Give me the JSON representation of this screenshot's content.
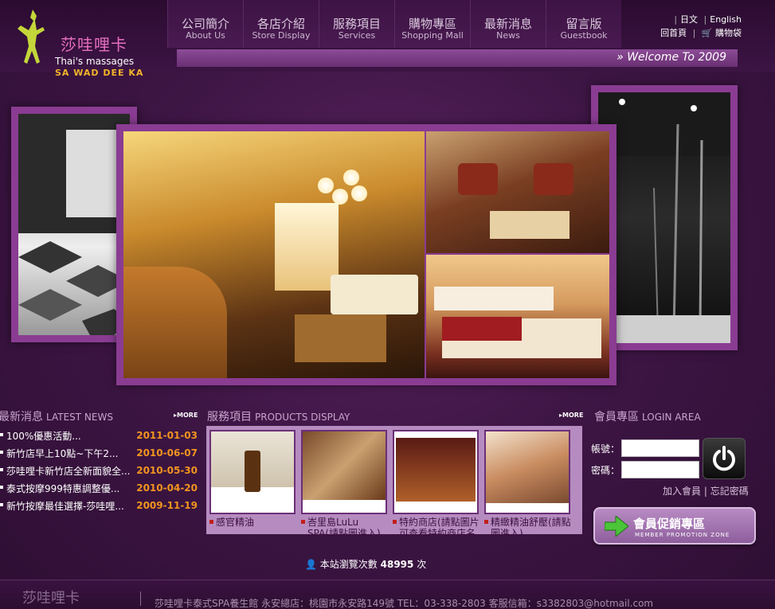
{
  "header": {
    "logo_cn": "莎哇哩卡",
    "logo_en": "Thai's massages",
    "logo_en2": "SA WAD DEE KA",
    "nav": [
      {
        "zh": "公司簡介",
        "en": "About Us"
      },
      {
        "zh": "各店介紹",
        "en": "Store Display"
      },
      {
        "zh": "服務項目",
        "en": "Services"
      },
      {
        "zh": "購物專區",
        "en": "Shopping Mall"
      },
      {
        "zh": "最新消息",
        "en": "News"
      },
      {
        "zh": "留言版",
        "en": "Guestbook"
      }
    ],
    "lang_ja": "日文",
    "lang_en": "English",
    "home": "回首頁",
    "cart": "購物袋",
    "welcome": "Welcome To 2009"
  },
  "news": {
    "title": "最新消息",
    "title_en": "LATEST NEWS",
    "more": "MORE",
    "items": [
      {
        "title": "100%優惠活動...",
        "date": "2011-01-03"
      },
      {
        "title": "新竹店早上10點~下午2...",
        "date": "2010-06-07"
      },
      {
        "title": "莎哇哩卡新竹店全新面貌全...",
        "date": "2010-05-30"
      },
      {
        "title": "泰式按摩999特惠調整優...",
        "date": "2010-04-20"
      },
      {
        "title": "新竹按摩最佳選擇-莎哇哩...",
        "date": "2009-11-19"
      }
    ]
  },
  "products": {
    "title": "服務項目",
    "title_en": "PRODUCTS DISPLAY",
    "more": "MORE",
    "items": [
      {
        "label": "感官精油"
      },
      {
        "label": "峇里島LuLu SPA(請點圖進入)"
      },
      {
        "label": "特約商店(請點圖片可查看特約商店名"
      },
      {
        "label": "精緻精油舒壓(請點圖進入)"
      }
    ]
  },
  "login": {
    "title": "會員專區",
    "title_en": "LOGIN  AREA",
    "account_label": "帳號：",
    "password_label": "密碼：",
    "join": "加入會員",
    "forgot": "忘記密碼",
    "promo": "會員促銷專區",
    "promo_en": "MEMBER PROMOTION ZONE"
  },
  "visitors": {
    "label": "本站瀏覽次數",
    "count": "48995",
    "unit": "次"
  },
  "footer": {
    "brand": "莎哇哩卡",
    "text": "莎哇哩卡泰式SPA養生館 永安總店：桃園市永安路149號 TEL：03-338-2803 客服信箱：s3382803@hotmail.com"
  }
}
